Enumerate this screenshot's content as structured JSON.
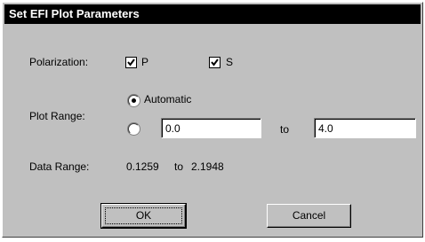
{
  "window": {
    "title": "Set EFI Plot Parameters"
  },
  "polarization": {
    "label": "Polarization:",
    "p": {
      "label": "P",
      "checked": true
    },
    "s": {
      "label": "S",
      "checked": true
    }
  },
  "plot_range": {
    "label": "Plot Range:",
    "automatic_label": "Automatic",
    "automatic_selected": true,
    "from_value": "0.0",
    "to_label": "to",
    "to_value": "4.0"
  },
  "data_range": {
    "label": "Data Range:",
    "min": "0.1259",
    "to_label": "to",
    "max": "2.1948"
  },
  "buttons": {
    "ok": "OK",
    "cancel": "Cancel"
  }
}
